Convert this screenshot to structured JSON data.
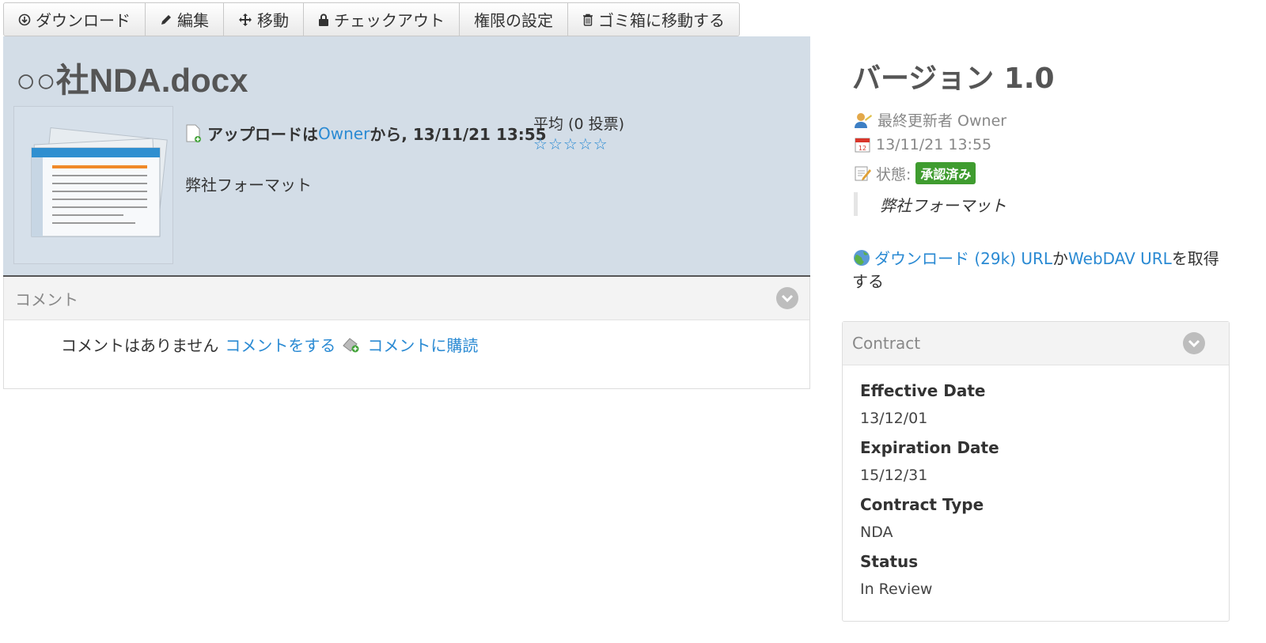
{
  "toolbar": {
    "download": "ダウンロード",
    "edit": "編集",
    "move": "移動",
    "checkout": "チェックアウト",
    "permissions": "権限の設定",
    "trash": "ゴミ箱に移動する"
  },
  "file": {
    "title": "○○社NDA.docx",
    "upload_prefix": "アップロードは",
    "upload_owner": "Owner",
    "upload_suffix": "から, 13/11/21 13:55",
    "description": "弊社フォーマット",
    "rating_text": "平均 (0 投票)",
    "stars": [
      "☆",
      "☆",
      "☆",
      "☆",
      "☆"
    ]
  },
  "comments": {
    "header": "コメント",
    "none_text": "コメントはありません",
    "add_link": "コメントをする",
    "subscribe_link": "コメントに購読"
  },
  "version": {
    "title": "バージョン 1.0",
    "updated_by": "最終更新者 Owner",
    "date": "13/11/21 13:55",
    "status_label": "状態:",
    "status_badge": "承認済み",
    "note": "弊社フォーマット",
    "download_link": "ダウンロード (29k) URL",
    "connector": "か",
    "webdav_link": "WebDAV URL",
    "get_suffix": "を取得する"
  },
  "contract": {
    "header": "Contract",
    "fields": [
      {
        "label": "Effective Date",
        "value": "13/12/01"
      },
      {
        "label": "Expiration Date",
        "value": "15/12/31"
      },
      {
        "label": "Contract Type",
        "value": "NDA"
      },
      {
        "label": "Status",
        "value": "In Review"
      }
    ]
  }
}
